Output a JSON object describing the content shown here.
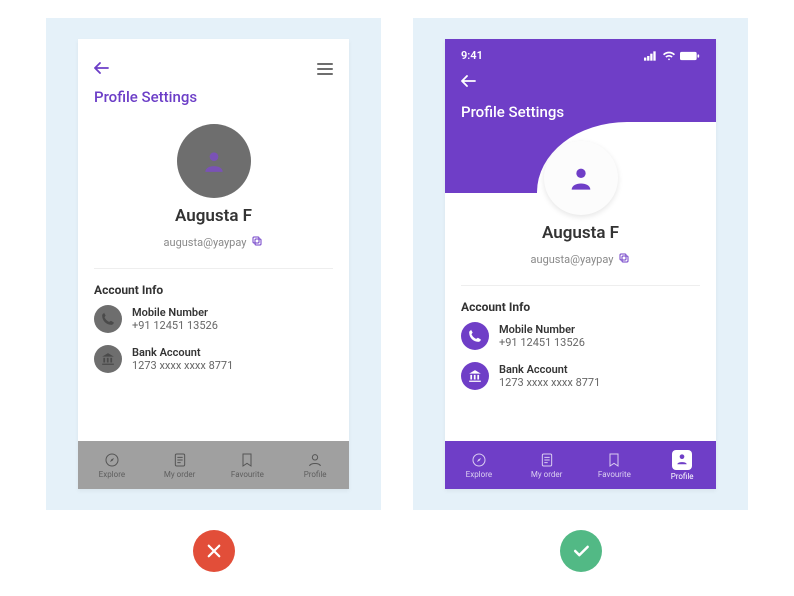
{
  "colors": {
    "accent": "#6f3ec7",
    "panel_bg": "#e5f1f9",
    "grey": "#6e6e6e",
    "bad": "#e24e39",
    "good": "#52b985"
  },
  "status_time": "9:41",
  "title": "Profile Settings",
  "profile": {
    "name": "Augusta F",
    "email": "augusta@yaypay"
  },
  "account_info": {
    "heading": "Account Info",
    "mobile": {
      "label": "Mobile Number",
      "value": "+91 12451 13526"
    },
    "bank": {
      "label": "Bank Account",
      "value": "1273 xxxx xxxx 8771"
    }
  },
  "nav": {
    "explore": "Explore",
    "order": "My order",
    "favourite": "Favourite",
    "profile": "Profile"
  }
}
